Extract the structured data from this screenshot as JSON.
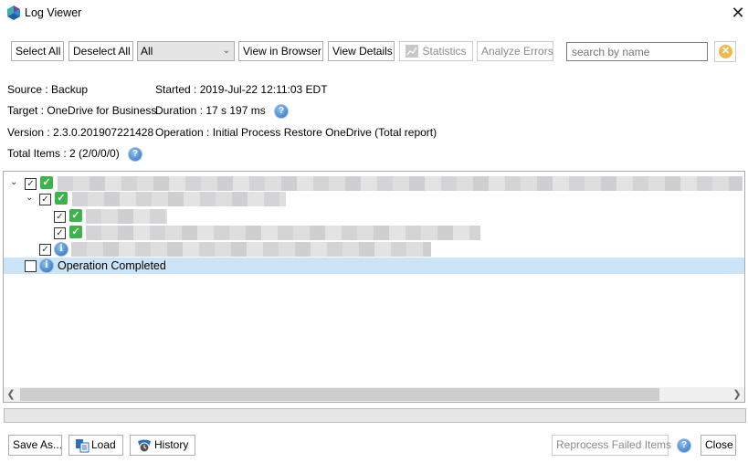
{
  "window": {
    "title": "Log Viewer",
    "close_glyph": "✕"
  },
  "toolbar": {
    "select_all": "Select All",
    "deselect_all": "Deselect All",
    "filter_value": "All",
    "view_in_browser": "View in Browser",
    "view_details": "View Details",
    "statistics": "Statistics",
    "analyze_errors": "Analyze Errors",
    "search_placeholder": "search by name",
    "clear_icon": "✕"
  },
  "info": {
    "source": "Source : Backup",
    "started": "Started : 2019-Jul-22 12:11:03 EDT",
    "target": "Target : OneDrive for Business",
    "duration": "Duration : 17 s 197 ms",
    "version": "Version : 2.3.0.201907221428",
    "operation": "Operation : Initial Process Restore OneDrive (Total report)",
    "total_items": "Total Items : 2 (2/0/0/0)",
    "help_glyph": "?"
  },
  "tree": {
    "rows": [
      {
        "level": 0,
        "expanded": true,
        "checked": true,
        "status": "success",
        "label": "[redacted]"
      },
      {
        "level": 1,
        "expanded": true,
        "checked": true,
        "status": "success",
        "label": "[redacted]"
      },
      {
        "level": 2,
        "checked": true,
        "status": "success",
        "label": "[redacted]"
      },
      {
        "level": 2,
        "checked": true,
        "status": "success",
        "label": "[redacted]"
      },
      {
        "level": 1,
        "checked": true,
        "status": "info",
        "label": "[redacted]"
      },
      {
        "level": 0,
        "checked": false,
        "status": "info",
        "label": "Operation Completed",
        "selected": true
      }
    ],
    "check_glyph": "✓",
    "expand_glyph": "⌄",
    "info_glyph": "i"
  },
  "footer": {
    "save_as": "Save As...",
    "load": "Load",
    "history": "History",
    "reprocess": "Reprocess Failed Items",
    "close": "Close"
  },
  "colors": {
    "selection": "#cce4f7",
    "success": "#3cb44a",
    "info": "#2267c0",
    "clear": "#f0b94a"
  }
}
